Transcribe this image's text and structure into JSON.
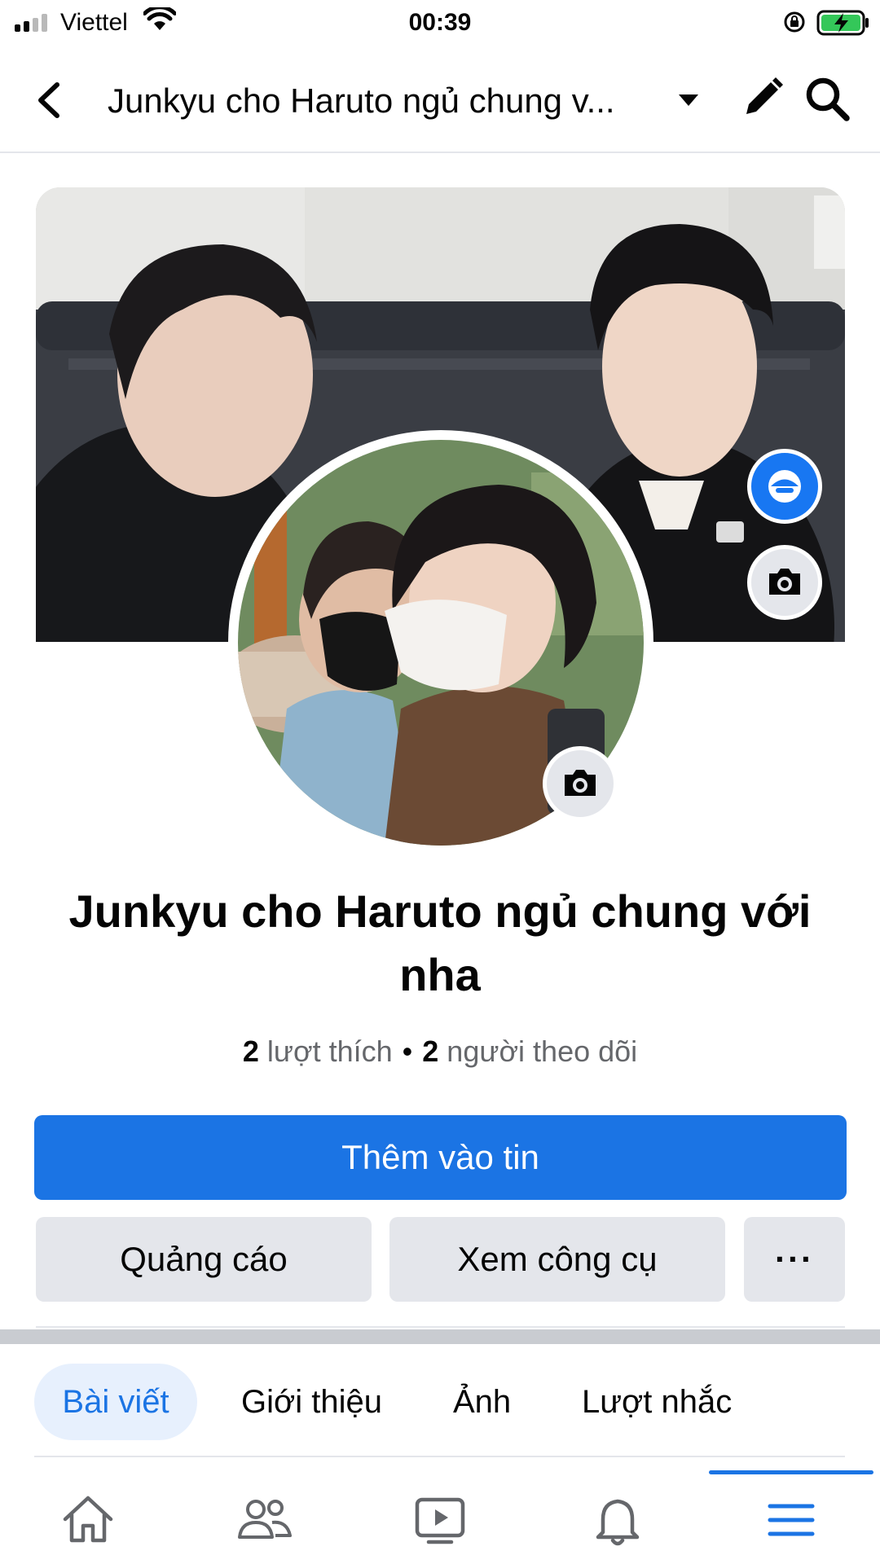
{
  "status_bar": {
    "carrier": "Viettel",
    "time": "00:39",
    "signal_bars_active": 2
  },
  "header": {
    "title": "Junkyu cho Haruto ngủ chung v...",
    "icons": [
      "back-icon",
      "caret-down-icon",
      "edit-icon",
      "search-icon"
    ]
  },
  "profile": {
    "name": "Junkyu cho Haruto ngủ chung với nha",
    "likes_count": "2",
    "likes_label": "lượt thích",
    "followers_count": "2",
    "followers_label": "người theo dõi"
  },
  "actions": {
    "primary_label": "Thêm vào tin",
    "ads_label": "Quảng cáo",
    "tools_label": "Xem công cụ",
    "more_label": "···"
  },
  "tabs": [
    {
      "label": "Bài viết",
      "active": true
    },
    {
      "label": "Giới thiệu",
      "active": false
    },
    {
      "label": "Ảnh",
      "active": false
    },
    {
      "label": "Lượt nhắc",
      "active": false
    }
  ],
  "bottom_nav": [
    "home-icon",
    "friends-icon",
    "watch-icon",
    "notifications-icon",
    "menu-icon"
  ],
  "colors": {
    "accent": "#1b74e4",
    "secondary_button": "#e4e6eb",
    "muted_text": "#65676b",
    "active_tab_bg": "#e7f0fd"
  }
}
